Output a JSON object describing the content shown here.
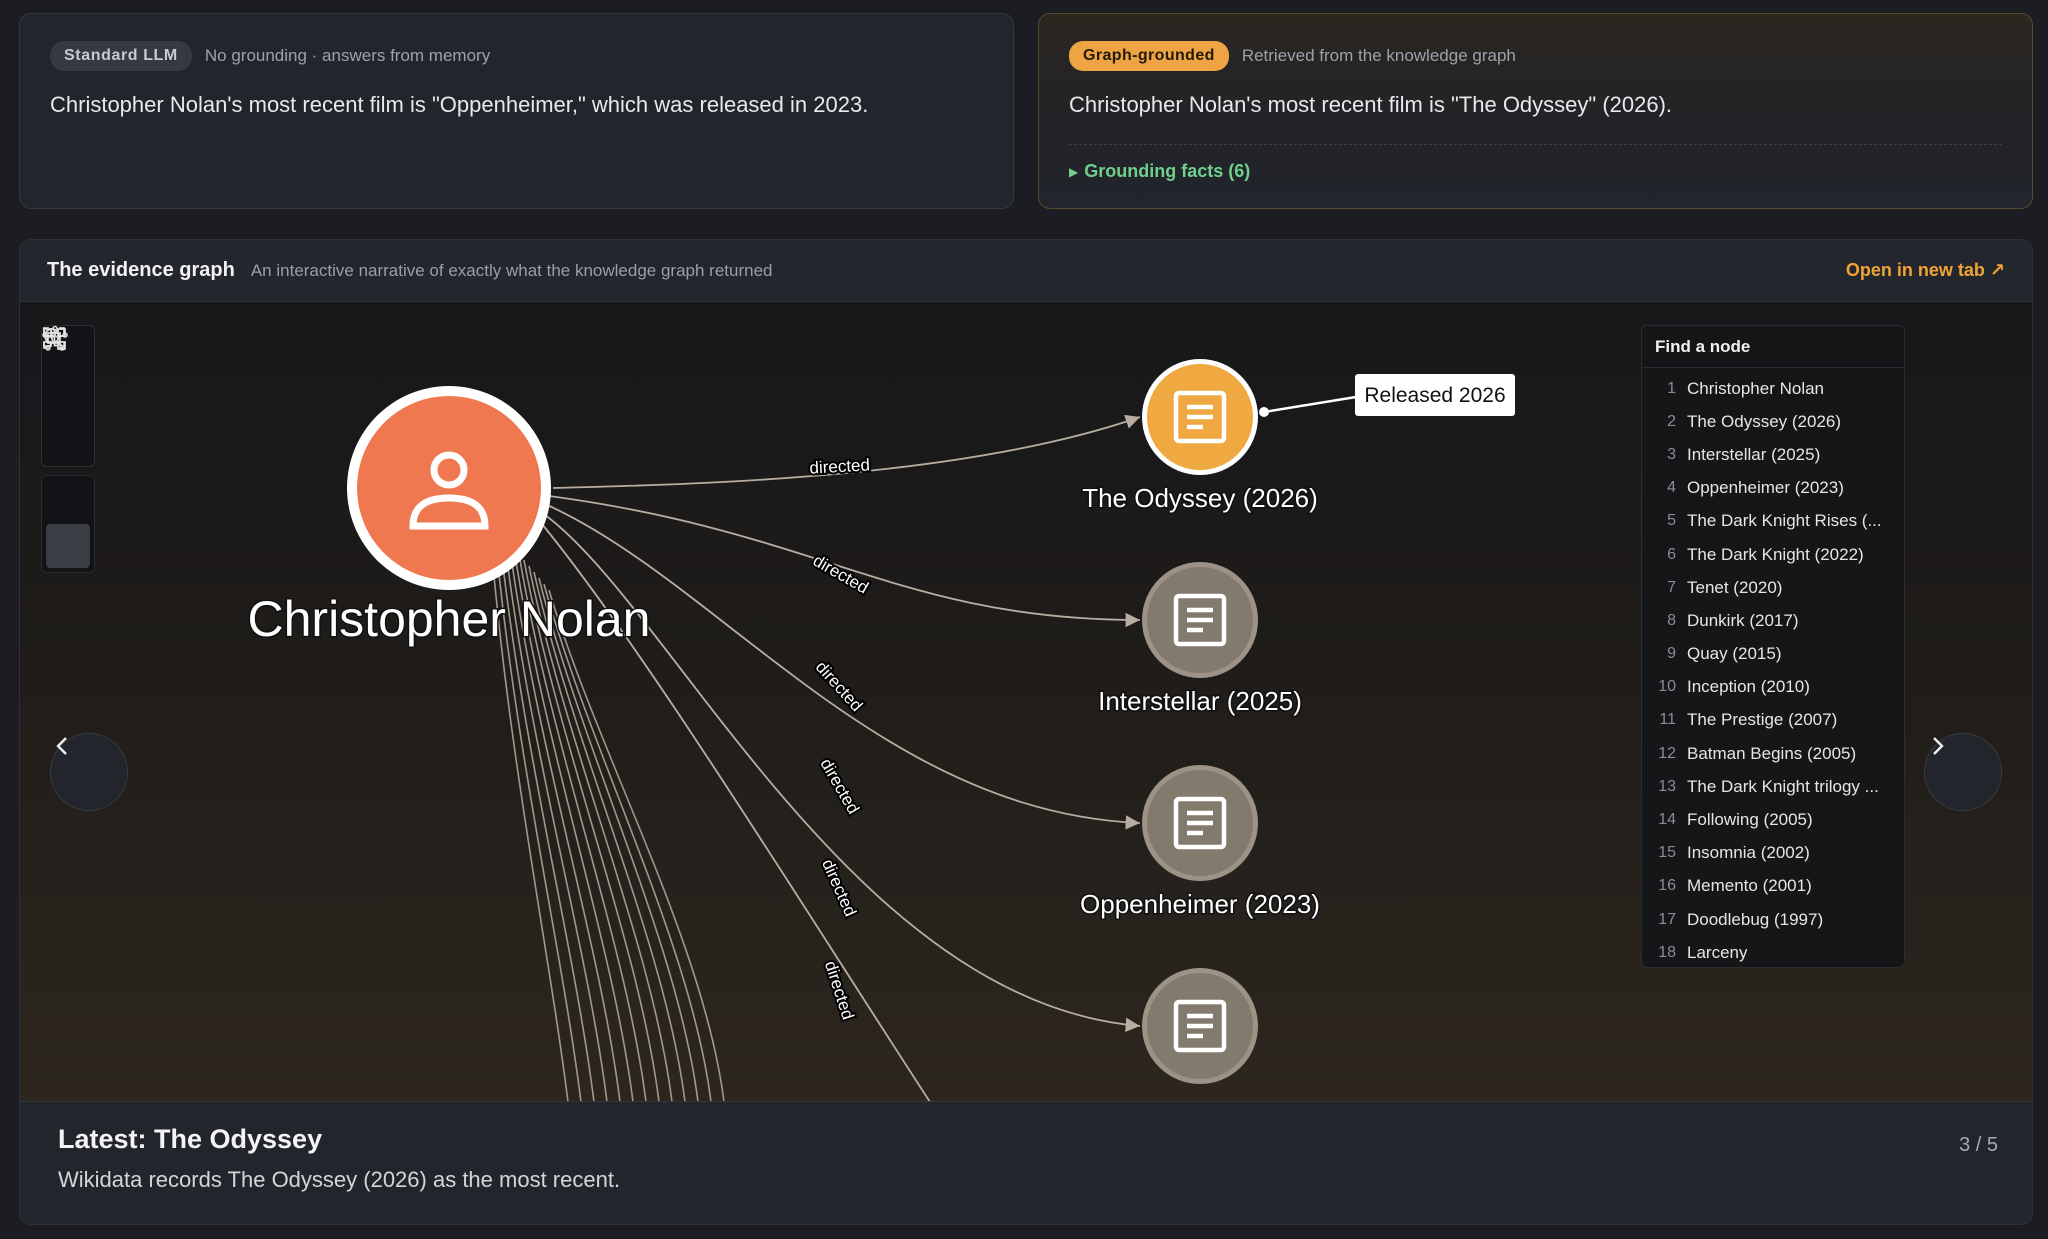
{
  "standard": {
    "badge": "Standard LLM",
    "subtitle": "No grounding · answers from memory",
    "answer": "Christopher Nolan's most recent film is \"Oppenheimer,\" which was released in 2023."
  },
  "grounded": {
    "badge": "Graph-grounded",
    "subtitle": "Retrieved from the knowledge graph",
    "answer": "Christopher Nolan's most recent film is \"The Odyssey\" (2026).",
    "facts_toggle": "Grounding facts (6)"
  },
  "evidence": {
    "title": "The evidence graph",
    "subtitle": "An interactive narrative of exactly what the knowledge graph returned",
    "open_link": "Open in new tab ↗",
    "toolbar_icons": [
      "zoom-in-icon",
      "fit-view-icon",
      "zoom-out-icon",
      "force-layout-icon",
      "tree-layout-icon"
    ]
  },
  "graph": {
    "center_label": "Christopher Nolan",
    "edge_label": "directed",
    "films": [
      "The Odyssey (2026)",
      "Interstellar (2025)",
      "Oppenheimer (2023)",
      ""
    ],
    "callout": "Released 2026",
    "colors": {
      "person": "#f07850",
      "highlight": "#f0a840",
      "film": "#837a6e",
      "edge": "#b7aea1"
    }
  },
  "find": {
    "title": "Find a node",
    "items": [
      {
        "n": "1",
        "label": "Christopher Nolan"
      },
      {
        "n": "2",
        "label": "The Odyssey (2026)"
      },
      {
        "n": "3",
        "label": "Interstellar (2025)"
      },
      {
        "n": "4",
        "label": "Oppenheimer (2023)"
      },
      {
        "n": "5",
        "label": "The Dark Knight Rises (..."
      },
      {
        "n": "6",
        "label": "The Dark Knight (2022)"
      },
      {
        "n": "7",
        "label": "Tenet (2020)"
      },
      {
        "n": "8",
        "label": "Dunkirk (2017)"
      },
      {
        "n": "9",
        "label": "Quay (2015)"
      },
      {
        "n": "10",
        "label": "Inception (2010)"
      },
      {
        "n": "11",
        "label": "The Prestige (2007)"
      },
      {
        "n": "12",
        "label": "Batman Begins (2005)"
      },
      {
        "n": "13",
        "label": "The Dark Knight trilogy ..."
      },
      {
        "n": "14",
        "label": "Following (2005)"
      },
      {
        "n": "15",
        "label": "Insomnia (2002)"
      },
      {
        "n": "16",
        "label": "Memento (2001)"
      },
      {
        "n": "17",
        "label": "Doodlebug (1997)"
      },
      {
        "n": "18",
        "label": "Larceny"
      }
    ]
  },
  "caption": {
    "title": "Latest: The Odyssey",
    "text": "Wikidata records The Odyssey (2026) as the most recent.",
    "step": "3 / 5"
  }
}
